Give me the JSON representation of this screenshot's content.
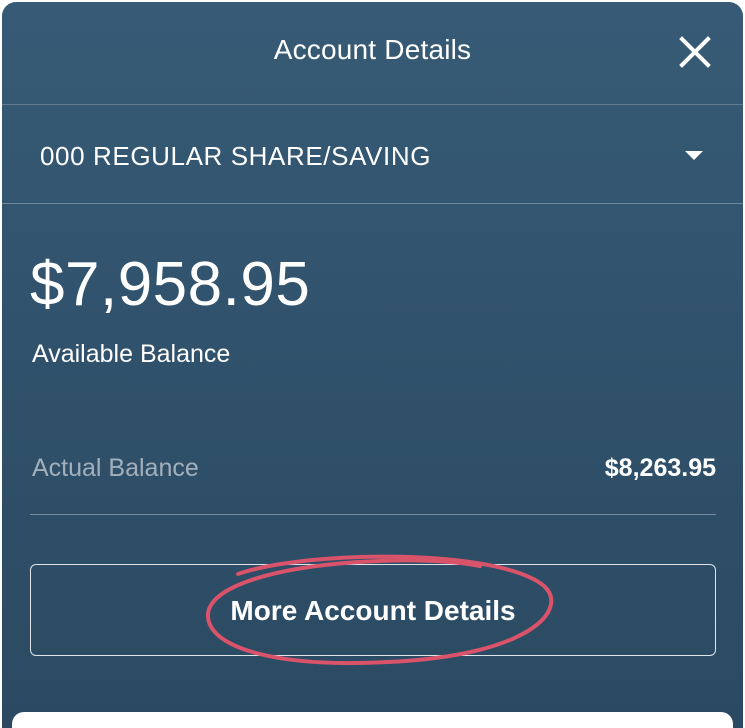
{
  "header": {
    "title": "Account Details",
    "close_icon": "close-icon"
  },
  "account_selector": {
    "selected": "000 REGULAR SHARE/SAVING",
    "dropdown_icon": "caret-down-icon"
  },
  "balances": {
    "available_amount": "$7,958.95",
    "available_label": "Available Balance",
    "actual_label": "Actual Balance",
    "actual_amount": "$8,263.95"
  },
  "actions": {
    "more_details_label": "More Account Details"
  },
  "colors": {
    "panel_top": "#375b76",
    "panel_bottom": "#2b4a62",
    "annotation": "#d9536a",
    "text": "#ffffff"
  }
}
